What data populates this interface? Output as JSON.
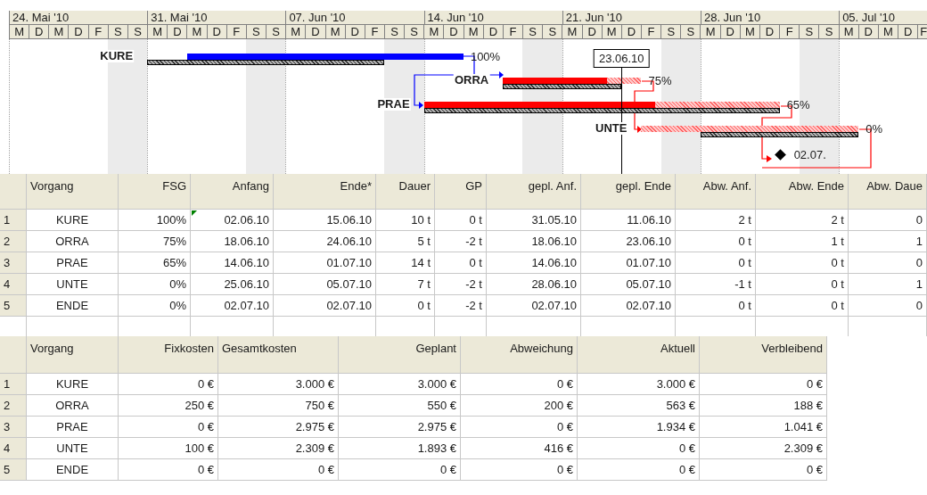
{
  "gantt": {
    "weeks": [
      {
        "label": "24. Mai '10",
        "days": [
          "M",
          "D",
          "M",
          "D",
          "F",
          "S",
          "S"
        ]
      },
      {
        "label": "31. Mai '10",
        "days": [
          "M",
          "D",
          "M",
          "D",
          "F",
          "S",
          "S"
        ]
      },
      {
        "label": "07. Jun '10",
        "days": [
          "M",
          "D",
          "M",
          "D",
          "F",
          "S",
          "S"
        ]
      },
      {
        "label": "14. Jun '10",
        "days": [
          "M",
          "D",
          "M",
          "D",
          "F",
          "S",
          "S"
        ]
      },
      {
        "label": "21. Jun '10",
        "days": [
          "M",
          "D",
          "M",
          "D",
          "F",
          "S",
          "S"
        ]
      },
      {
        "label": "28. Jun '10",
        "days": [
          "M",
          "D",
          "M",
          "D",
          "F",
          "S",
          "S"
        ]
      },
      {
        "label": "05. Jul '10",
        "days": [
          "M",
          "D",
          "M",
          "D",
          "F"
        ]
      }
    ],
    "status_date": "23.06.10",
    "tasks": [
      {
        "kind": "task",
        "label": "KURE",
        "percent": "100%",
        "level": 1,
        "critical": false
      },
      {
        "kind": "task",
        "label": "ORRA",
        "percent": "75%",
        "level": 0.75,
        "critical": true
      },
      {
        "kind": "task",
        "label": "PRAE",
        "percent": "65%",
        "level": 0.65,
        "critical": true
      },
      {
        "kind": "task",
        "label": "UNTE",
        "percent": "0%",
        "level": 0,
        "critical": true
      },
      {
        "kind": "milestone",
        "label": "02.07."
      }
    ]
  },
  "schedule_table": {
    "columns": [
      "Vorgang",
      "FSG",
      "Anfang",
      "Ende*",
      "Dauer",
      "GP",
      "gepl. Anf.",
      "gepl. Ende",
      "Abw. Anf.",
      "Abw. Ende",
      "Abw. Daue"
    ],
    "rows": [
      {
        "number": "1",
        "marked": true,
        "cells": [
          "KURE",
          "100%",
          "02.06.10",
          "15.06.10",
          "10 t",
          "0 t",
          "31.05.10",
          "11.06.10",
          "2 t",
          "2 t",
          "0"
        ]
      },
      {
        "number": "2",
        "marked": false,
        "cells": [
          "ORRA",
          "75%",
          "18.06.10",
          "24.06.10",
          "5 t",
          "-2 t",
          "18.06.10",
          "23.06.10",
          "0 t",
          "1 t",
          "1"
        ]
      },
      {
        "number": "3",
        "marked": false,
        "cells": [
          "PRAE",
          "65%",
          "14.06.10",
          "01.07.10",
          "14 t",
          "0 t",
          "14.06.10",
          "01.07.10",
          "0 t",
          "0 t",
          "0"
        ]
      },
      {
        "number": "4",
        "marked": false,
        "cells": [
          "UNTE",
          "0%",
          "25.06.10",
          "05.07.10",
          "7 t",
          "-2 t",
          "28.06.10",
          "05.07.10",
          "-1 t",
          "0 t",
          "1"
        ]
      },
      {
        "number": "5",
        "marked": false,
        "cells": [
          "ENDE",
          "0%",
          "02.07.10",
          "02.07.10",
          "0 t",
          "-2 t",
          "02.07.10",
          "02.07.10",
          "0 t",
          "0 t",
          "0"
        ]
      }
    ]
  },
  "cost_table": {
    "columns": [
      "Vorgang",
      "Fixkosten",
      "Gesamtkosten",
      "Geplant",
      "Abweichung",
      "Aktuell",
      "Verbleibend"
    ],
    "rows": [
      {
        "number": "1",
        "cells": [
          "KURE",
          "0 €",
          "3.000 €",
          "3.000 €",
          "0 €",
          "3.000 €",
          "0 €"
        ]
      },
      {
        "number": "2",
        "cells": [
          "ORRA",
          "250 €",
          "750 €",
          "550 €",
          "200 €",
          "563 €",
          "188 €"
        ]
      },
      {
        "number": "3",
        "cells": [
          "PRAE",
          "0 €",
          "2.975 €",
          "2.975 €",
          "0 €",
          "1.934 €",
          "1.041 €"
        ]
      },
      {
        "number": "4",
        "cells": [
          "UNTE",
          "100 €",
          "2.309 €",
          "1.893 €",
          "416 €",
          "0 €",
          "2.309 €"
        ]
      },
      {
        "number": "5",
        "cells": [
          "ENDE",
          "0 €",
          "0 €",
          "0 €",
          "0 €",
          "0 €",
          "0 €"
        ]
      }
    ]
  }
}
